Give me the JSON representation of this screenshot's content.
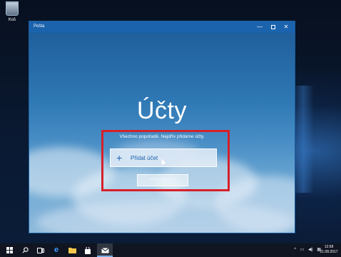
{
  "desktop": {
    "recycle_bin_label": "Koš"
  },
  "window": {
    "title": "Pošta",
    "controls": {
      "minimize": "—",
      "close": "✕"
    },
    "heading": "Účty",
    "subtitle": "Všechno popořadě. Nejdřív přidáme účty.",
    "add_account_label": "Přidat účet",
    "add_account_icon": "+",
    "start_label": "Můžeme začít"
  },
  "taskbar": {
    "icons": [
      "start-icon",
      "search-icon",
      "task-view-icon",
      "edge-icon",
      "file-explorer-icon",
      "store-icon",
      "mail-icon"
    ],
    "tray": {
      "chevron": "^",
      "network": "▭",
      "volume": "◀)",
      "keyboard": "▦"
    },
    "clock": {
      "time": "12:58",
      "date": "21.08.2017"
    }
  },
  "colors": {
    "title_bar": "#1b63ad",
    "highlight_border": "#d6202a",
    "accent_text": "#1b63ad"
  }
}
